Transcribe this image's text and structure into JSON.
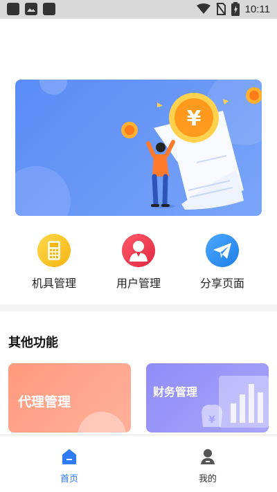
{
  "status_bar": {
    "time": "10:11"
  },
  "quick_menu": [
    {
      "label": "机具管理",
      "icon": "calculator-icon",
      "color": "#f8c21c"
    },
    {
      "label": "用户管理",
      "icon": "user-icon",
      "color": "#e9394a"
    },
    {
      "label": "分享页面",
      "icon": "paper-plane-icon",
      "color": "#2d8ef0"
    }
  ],
  "section": {
    "title": "其他功能"
  },
  "cards": [
    {
      "label": "代理管理",
      "color": "#ff9a7e"
    },
    {
      "label": "财务管理",
      "color": "#8f8cf7"
    }
  ],
  "tabbar": [
    {
      "label": "首页",
      "icon": "home-icon",
      "active": true,
      "color": "#2f7cf6"
    },
    {
      "label": "我的",
      "icon": "profile-icon",
      "active": false,
      "color": "#333333"
    }
  ]
}
